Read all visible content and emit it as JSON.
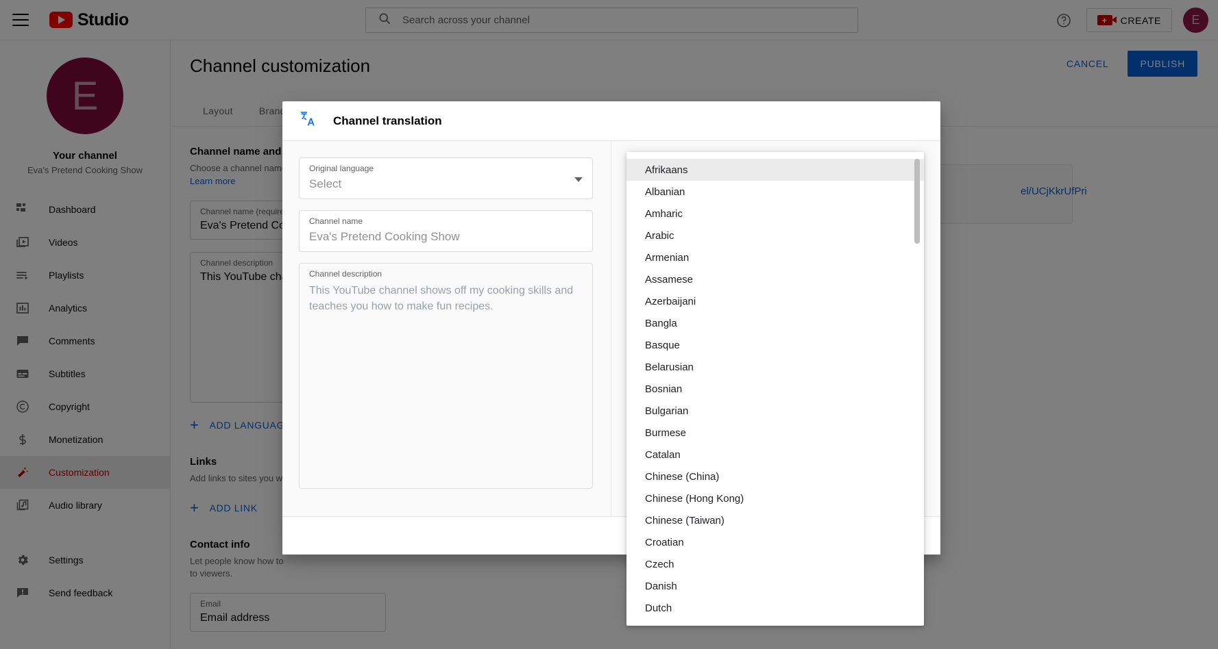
{
  "topbar": {
    "menu_icon": "hamburger-menu-icon",
    "logo_text": "Studio",
    "search_placeholder": "Search across your channel",
    "search_icon": "search-icon",
    "help_icon": "help-circle-icon",
    "create_label": "CREATE",
    "create_icon": "video-camera-plus-icon",
    "avatar_letter": "E"
  },
  "sidebar": {
    "avatar_letter": "E",
    "your_channel_label": "Your channel",
    "channel_name": "Eva's Pretend Cooking Show",
    "items": [
      {
        "label": "Dashboard",
        "icon": "dashboard-icon"
      },
      {
        "label": "Videos",
        "icon": "video-library-icon"
      },
      {
        "label": "Playlists",
        "icon": "playlist-icon"
      },
      {
        "label": "Analytics",
        "icon": "analytics-bar-chart-icon"
      },
      {
        "label": "Comments",
        "icon": "comment-bubble-icon"
      },
      {
        "label": "Subtitles",
        "icon": "subtitles-icon"
      },
      {
        "label": "Copyright",
        "icon": "copyright-icon"
      },
      {
        "label": "Monetization",
        "icon": "dollar-sign-icon"
      },
      {
        "label": "Customization",
        "icon": "magic-wand-icon"
      },
      {
        "label": "Audio library",
        "icon": "audio-note-icon"
      }
    ],
    "bottom_items": [
      {
        "label": "Settings",
        "icon": "gear-icon"
      },
      {
        "label": "Send feedback",
        "icon": "feedback-icon"
      }
    ]
  },
  "main": {
    "page_title": "Channel customization",
    "tabs": [
      {
        "label": "Layout"
      },
      {
        "label": "Brandi"
      }
    ],
    "cancel_label": "CANCEL",
    "publish_label": "PUBLISH",
    "sections": {
      "name_desc": {
        "heading": "Channel name and d",
        "paragraph": "Choose a channel name",
        "learn_more": "Learn more",
        "channel_name_label": "Channel name (require",
        "channel_name_value": "Eva's Pretend Cool",
        "channel_desc_label": "Channel description",
        "channel_desc_value": "This YouTube chan",
        "add_language_label": "ADD LANGUAGE"
      },
      "links": {
        "heading": "Links",
        "paragraph": "Add links to sites you wa",
        "add_link_label": "ADD LINK"
      },
      "contact": {
        "heading": "Contact info",
        "paragraph_line1": "Let people know how to",
        "paragraph_line2": "to viewers.",
        "email_label": "Email",
        "email_value": "Email address"
      },
      "channel_url_fragment": "el/UCjKkrUfPri"
    }
  },
  "modal": {
    "icon": "translate-icon",
    "title": "Channel translation",
    "original_language": {
      "label": "Original language",
      "value": "Select",
      "caret_icon": "chevron-down-icon"
    },
    "channel_name": {
      "label": "Channel name",
      "placeholder": "Eva's Pretend Cooking Show"
    },
    "channel_description": {
      "label": "Channel description",
      "placeholder": "This YouTube channel shows off my cooking skills and teaches you how to make fun recipes."
    }
  },
  "language_dropdown": {
    "highlighted": "Afrikaans",
    "options": [
      "Afrikaans",
      "Albanian",
      "Amharic",
      "Arabic",
      "Armenian",
      "Assamese",
      "Azerbaijani",
      "Bangla",
      "Basque",
      "Belarusian",
      "Bosnian",
      "Bulgarian",
      "Burmese",
      "Catalan",
      "Chinese (China)",
      "Chinese (Hong Kong)",
      "Chinese (Taiwan)",
      "Croatian",
      "Czech",
      "Danish",
      "Dutch"
    ]
  },
  "colors": {
    "brand_red": "#ff0000",
    "accent_blue": "#065fd4",
    "avatar_bg": "#7c0b39",
    "active_nav": "#c00000"
  }
}
